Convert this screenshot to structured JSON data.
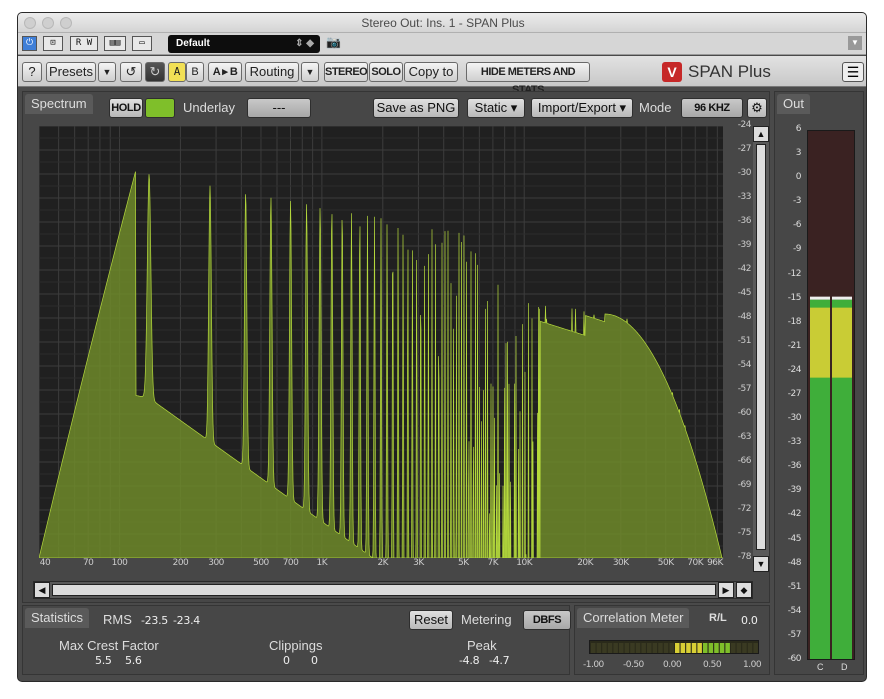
{
  "window": {
    "title": "Stereo Out: Ins. 1 - SPAN Plus"
  },
  "host": {
    "buttons": [
      "⏻",
      "⊡",
      "R W",
      "▤▤",
      "▭"
    ],
    "preset_value": "Default"
  },
  "toolbar": {
    "help": "?",
    "presets": "Presets",
    "dd": "▼",
    "undo": "↺",
    "a": "A",
    "b": "B",
    "ab": "A ▸ B",
    "routing": "Routing",
    "stereo": "STEREO",
    "solo": "SOLO",
    "copyto": "Copy to",
    "hide": "HIDE METERS AND STATS",
    "logo_mark": "V",
    "logo_text": "SPAN Plus",
    "menu": "☰"
  },
  "spectrum": {
    "tab": "Spectrum",
    "hold": "HOLD",
    "underlay_label": "Underlay",
    "underlay_value": "---",
    "save": "Save as PNG",
    "static": "Static ▾",
    "import_export": "Import/Export ▾",
    "mode_label": "Mode",
    "mode_value": "96 KHZ",
    "y_ticks": [
      "-24",
      "-27",
      "-30",
      "-33",
      "-36",
      "-39",
      "-42",
      "-45",
      "-48",
      "-51",
      "-54",
      "-57",
      "-60",
      "-63",
      "-66",
      "-69",
      "-72",
      "-75",
      "-78"
    ],
    "x_ticks": [
      "40",
      "70",
      "100",
      "200",
      "300",
      "500",
      "700",
      "1K",
      "2K",
      "3K",
      "5K",
      "7K",
      "10K",
      "20K",
      "30K",
      "50K",
      "70K",
      "96K"
    ]
  },
  "out": {
    "tab": "Out",
    "ticks": [
      "6",
      "3",
      "0",
      "-3",
      "-6",
      "-9",
      "-12",
      "-15",
      "-18",
      "-21",
      "-24",
      "-27",
      "-30",
      "-33",
      "-36",
      "-39",
      "-42",
      "-45",
      "-48",
      "-51",
      "-54",
      "-57",
      "-60"
    ],
    "channels": [
      "C",
      "D"
    ],
    "level_db": -15
  },
  "stats": {
    "tab": "Statistics",
    "rms_label": "RMS",
    "rms_l": "-23.5",
    "rms_r": "-23.4",
    "reset": "Reset",
    "metering_label": "Metering",
    "metering_value": "DBFS",
    "crest_label": "Max Crest Factor",
    "crest_l": "5.5",
    "crest_r": "5.6",
    "clip_label": "Clippings",
    "clip_l": "0",
    "clip_r": "0",
    "peak_label": "Peak",
    "peak_l": "-4.8",
    "peak_r": "-4.7"
  },
  "corr": {
    "tab": "Correlation Meter",
    "rl": "R/L",
    "value": "0.0",
    "ticks": [
      "-1.00",
      "-0.50",
      "0.00",
      "0.50",
      "1.00"
    ]
  },
  "colors": {
    "spectrum_fill": "#6e8a2a",
    "spectrum_edge": "#b4d83c",
    "meter_green": "#3fae3a",
    "meter_yellow": "#d8cf35"
  }
}
